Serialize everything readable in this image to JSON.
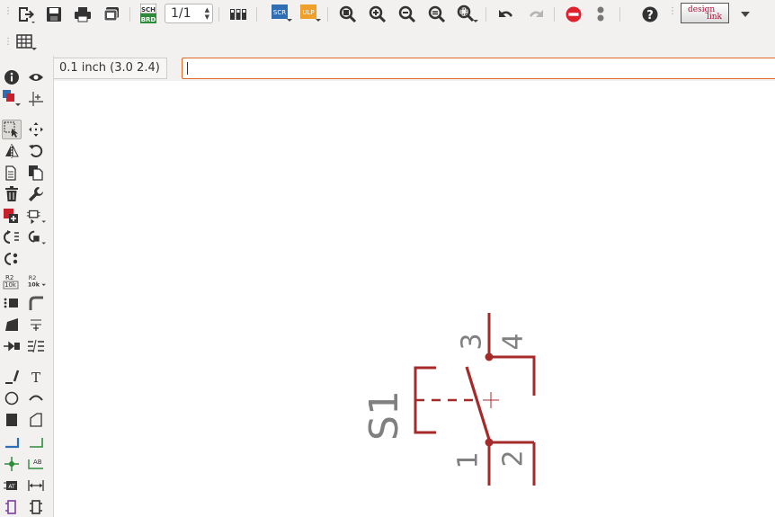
{
  "toolbar": {
    "page_selector_value": "1/1",
    "sch_brd_label_top": "SCH",
    "sch_brd_label_bottom": "BRD",
    "scr_label": "SCR",
    "ulp_label": "ULP",
    "logo_text_top": "design",
    "logo_text_bottom": "link"
  },
  "toolbar2": {
    "grid_icon": "grid-icon"
  },
  "command_bar": {
    "coordinate_display": "0.1 inch (3.0 2.4)",
    "command_value": ""
  },
  "sidebar": {
    "labels": {
      "r2_top": "R2",
      "r2_bottom": "10k",
      "r2b_top": "R2",
      "r2b_bottom": "10k",
      "text_tool": "T",
      "ab_label": "AB",
      "at_label": "AT"
    }
  },
  "schematic": {
    "part_name": "S1",
    "pin_labels": [
      "3",
      "4",
      "1",
      "2"
    ],
    "colors": {
      "symbol": "#a52a2a",
      "text": "#808080"
    }
  },
  "colors": {
    "toolbar_bg": "#f2f1f0",
    "accent_orange": "#e0691f",
    "stop_red": "#e0202c",
    "scr_blue": "#2f6db5",
    "ulp_orange": "#f0a02a"
  }
}
